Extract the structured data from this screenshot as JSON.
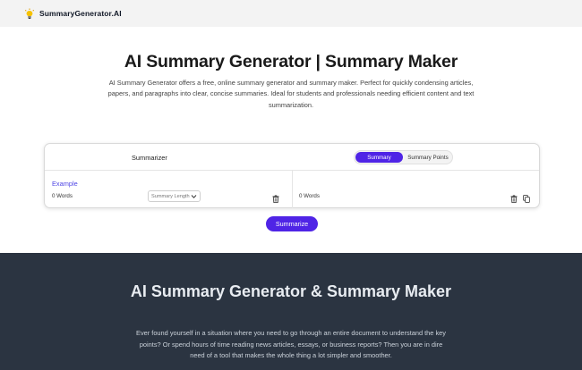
{
  "header": {
    "brand": "SummaryGenerator.AI",
    "logo_icon": "lightbulb-icon"
  },
  "hero": {
    "title": "AI Summary Generator | Summary Maker",
    "description": "AI Summary Generator offers a free, online summary generator and summary maker. Perfect for quickly condensing articles, papers, and paragraphs into clear, concise summaries. Ideal for students and professionals needing efficient content and text summarization."
  },
  "tool": {
    "title": "Summarizer",
    "modes": [
      "Summary",
      "Summary Points"
    ],
    "active_mode": "Summary",
    "example_label": "Example",
    "input_word_count": "0 Words",
    "length_placeholder": "Summary Length",
    "output_word_count": "0 Words",
    "summarize_label": "Summarize"
  },
  "about": {
    "title": "AI Summary Generator & Summary Maker",
    "description": "Ever found yourself in a situation where you need to go through an entire document to understand the key points? Or spend hours of time reading news articles, essays, or business reports? Then you are in dire need of a tool that makes the whole thing a lot simpler and smoother."
  },
  "colors": {
    "accent": "#4f24e6",
    "dark_section": "#2b3441"
  }
}
